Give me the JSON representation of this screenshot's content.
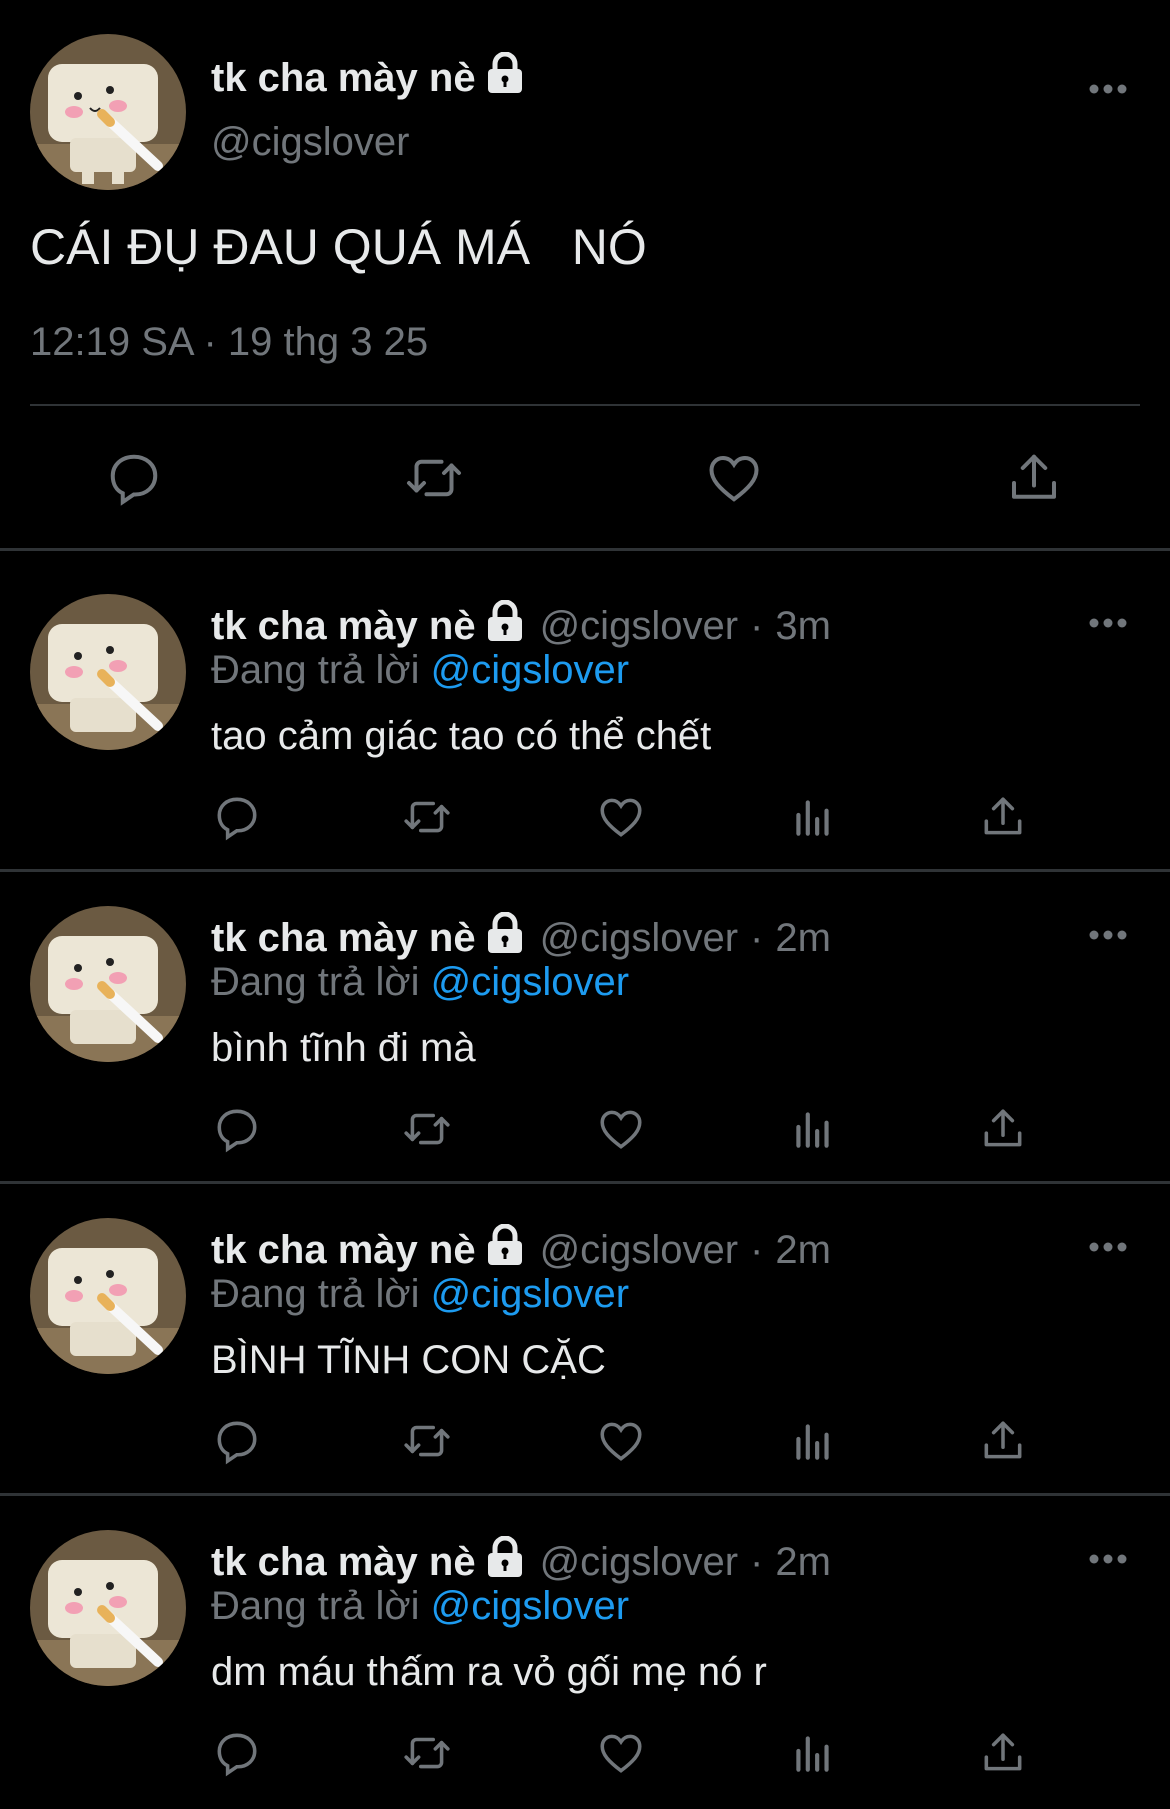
{
  "colors": {
    "background": "#000000",
    "primary_text": "#e7e9ea",
    "secondary_text": "#71767b",
    "link": "#1d9bf0",
    "divider": "#2f3336"
  },
  "main_tweet": {
    "display_name": "tk cha mày nè",
    "handle": "@cigslover",
    "text": "CÁI ĐỤ ĐAU QUÁ MÁ   NÓ",
    "timestamp": "12:19 SA · 19 thg 3 25",
    "icons": [
      "lock-icon",
      "more-icon",
      "reply-icon",
      "retweet-icon",
      "like-icon",
      "share-icon"
    ]
  },
  "replies": [
    {
      "display_name": "tk cha mày nè",
      "handle": "@cigslover",
      "dot": "·",
      "time": "3m",
      "replying_prefix": "Đang trả lời",
      "replying_handle": "@cigslover",
      "text": "tao cảm giác tao có thể chết"
    },
    {
      "display_name": "tk cha mày nè",
      "handle": "@cigslover",
      "dot": "·",
      "time": "2m",
      "replying_prefix": "Đang trả lời",
      "replying_handle": "@cigslover",
      "text": "bình tĩnh đi mà"
    },
    {
      "display_name": "tk cha mày nè",
      "handle": "@cigslover",
      "dot": "·",
      "time": "2m",
      "replying_prefix": "Đang trả lời",
      "replying_handle": "@cigslover",
      "text": "BÌNH TĨNH CON CẶC"
    },
    {
      "display_name": "tk cha mày nè",
      "handle": "@cigslover",
      "dot": "·",
      "time": "2m",
      "replying_prefix": "Đang trả lời",
      "replying_handle": "@cigslover",
      "text": "dm máu thấm ra vỏ gối mẹ nó r"
    }
  ]
}
